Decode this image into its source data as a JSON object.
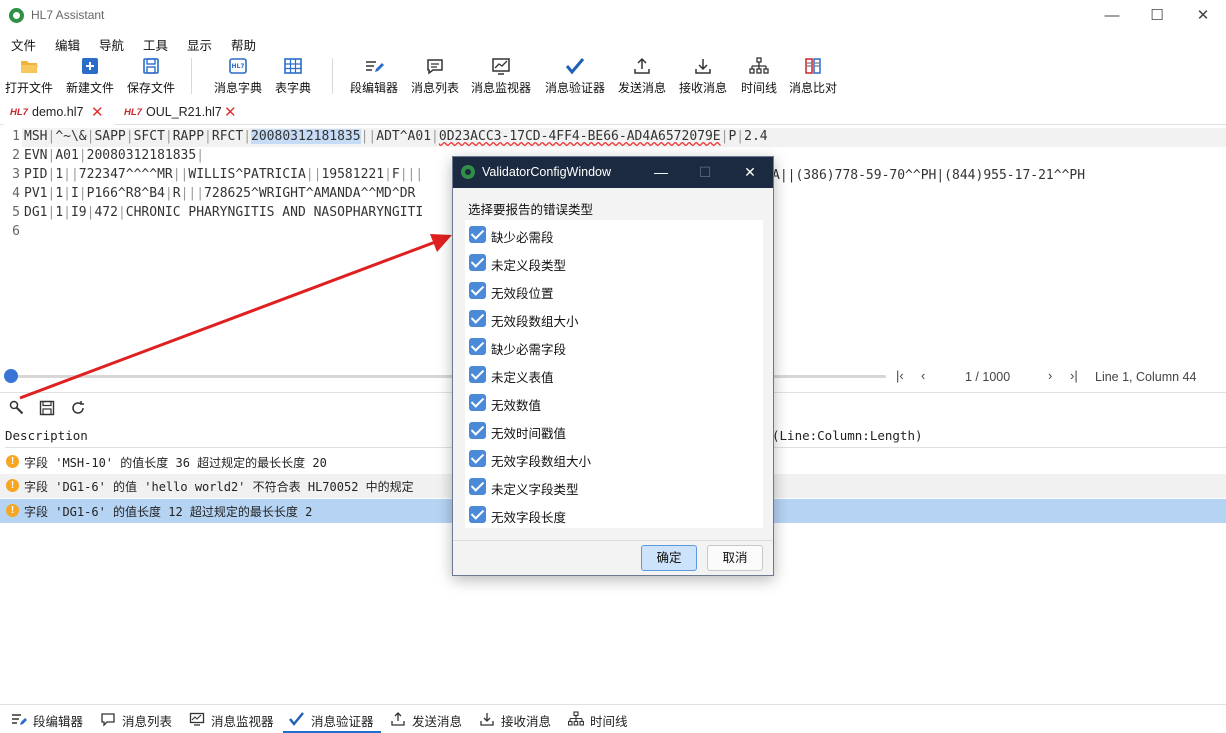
{
  "window": {
    "title": "HL7 Assistant",
    "minimize": "—",
    "maximize": "☐",
    "close": "✕"
  },
  "menu": [
    "文件",
    "编辑",
    "导航",
    "工具",
    "显示",
    "帮助"
  ],
  "toolbar": [
    {
      "label": "打开文件",
      "icon": "open-folder-icon"
    },
    {
      "label": "新建文件",
      "icon": "new-file-icon"
    },
    {
      "label": "保存文件",
      "icon": "save-icon"
    },
    {
      "label": "消息字典",
      "icon": "message-dictionary-icon"
    },
    {
      "label": "表字典",
      "icon": "table-dictionary-icon"
    },
    {
      "label": "段编辑器",
      "icon": "segment-editor-icon"
    },
    {
      "label": "消息列表",
      "icon": "message-list-icon"
    },
    {
      "label": "消息监视器",
      "icon": "message-monitor-icon"
    },
    {
      "label": "消息验证器",
      "icon": "checkmark-icon"
    },
    {
      "label": "发送消息",
      "icon": "upload-icon"
    },
    {
      "label": "接收消息",
      "icon": "download-icon"
    },
    {
      "label": "时间线",
      "icon": "timeline-icon"
    },
    {
      "label": "消息比对",
      "icon": "compare-icon"
    }
  ],
  "tabs": [
    {
      "badge": "HL7",
      "name": "demo.hl7",
      "close": "✕",
      "active": true
    },
    {
      "badge": "HL7",
      "name": "OUL_R21.hl7",
      "close": "✕",
      "active": false
    }
  ],
  "editor": {
    "line_numbers": [
      "1",
      "2",
      "3",
      "4",
      "5",
      "6"
    ],
    "lines": [
      [
        "MSH",
        "|",
        "^~\\&",
        "|",
        "SAPP",
        "|",
        "SFCT",
        "|",
        "RAPP",
        "|",
        "RFCT",
        "|",
        "20080312181835",
        "||",
        "ADT^A01",
        "|",
        "0D23ACC3-17CD-4FF4-BE66-AD4A6572079E",
        "|",
        "P",
        "|",
        "2.4"
      ],
      [
        "EVN",
        "|",
        "A01",
        "|",
        "20080312181835",
        "|"
      ],
      [
        "PID",
        "|",
        "1",
        "||",
        "722347^^^^MR",
        "||",
        "WILLIS^PATRICIA",
        "||",
        "19581221",
        "|",
        "F",
        "|||"
      ],
      [
        "PV1",
        "|",
        "1",
        "|",
        "I",
        "|",
        "P166^R8^B4",
        "|",
        "R",
        "|||",
        "728625^WRIGHT^AMANDA^^MD^DR"
      ],
      [
        "DG1",
        "|",
        "1",
        "|",
        "I9",
        "|",
        "472",
        "|",
        "CHRONIC PHARYNGITIS AND NASOPHARYNGITI"
      ],
      []
    ],
    "line3_tail": "A||(386)778-59-70^^PH|(844)955-17-21^^PH"
  },
  "status": {
    "page": "1 / 1000",
    "position": "Line 1, Column 44",
    "first": "|‹",
    "prev": "‹",
    "next": "›",
    "last": "›|"
  },
  "results": {
    "columns": [
      "Description",
      "(Line:Column:Length)"
    ],
    "rows": [
      {
        "severity": "!",
        "text": "字段 'MSH-10' 的值长度 36 超过规定的最长长度 20"
      },
      {
        "severity": "!",
        "text": "字段 'DG1-6' 的值 'hello world2' 不符合表 HL70052 中的规定"
      },
      {
        "severity": "!",
        "text": "字段 'DG1-6' 的值长度 12 超过规定的最长长度 2"
      }
    ]
  },
  "bottom_tabs": [
    {
      "label": "段编辑器",
      "icon": "segment-editor-icon"
    },
    {
      "label": "消息列表",
      "icon": "message-list-icon"
    },
    {
      "label": "消息监视器",
      "icon": "message-monitor-icon"
    },
    {
      "label": "消息验证器",
      "icon": "checkmark-icon",
      "active": true
    },
    {
      "label": "发送消息",
      "icon": "upload-icon"
    },
    {
      "label": "接收消息",
      "icon": "download-icon"
    },
    {
      "label": "时间线",
      "icon": "timeline-icon"
    }
  ],
  "dialog": {
    "title": "ValidatorConfigWindow",
    "minimize": "—",
    "maximize": "☐",
    "close": "✕",
    "prompt": "选择要报告的错误类型",
    "options": [
      {
        "label": "缺少必需段",
        "checked": true
      },
      {
        "label": "未定义段类型",
        "checked": true
      },
      {
        "label": "无效段位置",
        "checked": true
      },
      {
        "label": "无效段数组大小",
        "checked": true
      },
      {
        "label": "缺少必需字段",
        "checked": true
      },
      {
        "label": "未定义表值",
        "checked": true
      },
      {
        "label": "无效数值",
        "checked": true
      },
      {
        "label": "无效时间戳值",
        "checked": true
      },
      {
        "label": "无效字段数组大小",
        "checked": true
      },
      {
        "label": "未定义字段类型",
        "checked": true
      },
      {
        "label": "无效字段长度",
        "checked": true
      }
    ],
    "ok": "确定",
    "cancel": "取消"
  },
  "colors": {
    "accent": "#1e6fd0",
    "dialog_title_bg": "#1b2a40",
    "warning": "#f5a623",
    "selected_row": "#b5d3f3",
    "arrow": "#e02020"
  }
}
